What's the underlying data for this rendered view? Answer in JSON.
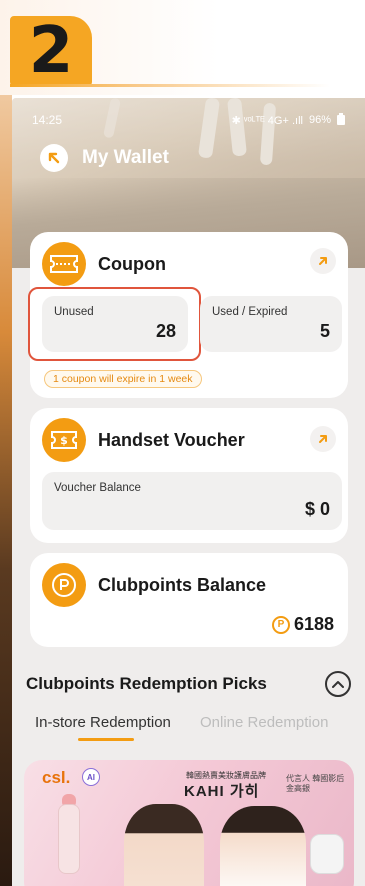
{
  "step": {
    "number": "2"
  },
  "status_bar": {
    "time": "14:25",
    "icons": "✱ ᵛᵒᴸᵀᴱ 4G+ .ıll",
    "battery": "96%"
  },
  "header": {
    "title": "My Wallet",
    "back_icon": "arrow-up-left-icon"
  },
  "coupon": {
    "title": "Coupon",
    "unused_label": "Unused",
    "unused_value": "28",
    "used_label": "Used / Expired",
    "used_value": "5",
    "expire_note": "1 coupon will expire in 1 week"
  },
  "voucher": {
    "title": "Handset Voucher",
    "balance_label": "Voucher Balance",
    "balance_value": "$ 0"
  },
  "clubpoints": {
    "title": "Clubpoints Balance",
    "value": "6188"
  },
  "redemption": {
    "title": "Clubpoints Redemption Picks",
    "tabs": [
      {
        "label": "In-store Redemption",
        "active": true
      },
      {
        "label": "Online Redemption",
        "active": false
      }
    ]
  },
  "banner": {
    "brand": "csl.",
    "ai_badge": "AI",
    "kr_text": "韓國熱賣美妝護膚品牌",
    "kahi": "KAHI 가히",
    "rep_text": "代言人 韓國影后 金高銀"
  },
  "colors": {
    "accent": "#f39c12",
    "highlight": "#e0553c"
  }
}
